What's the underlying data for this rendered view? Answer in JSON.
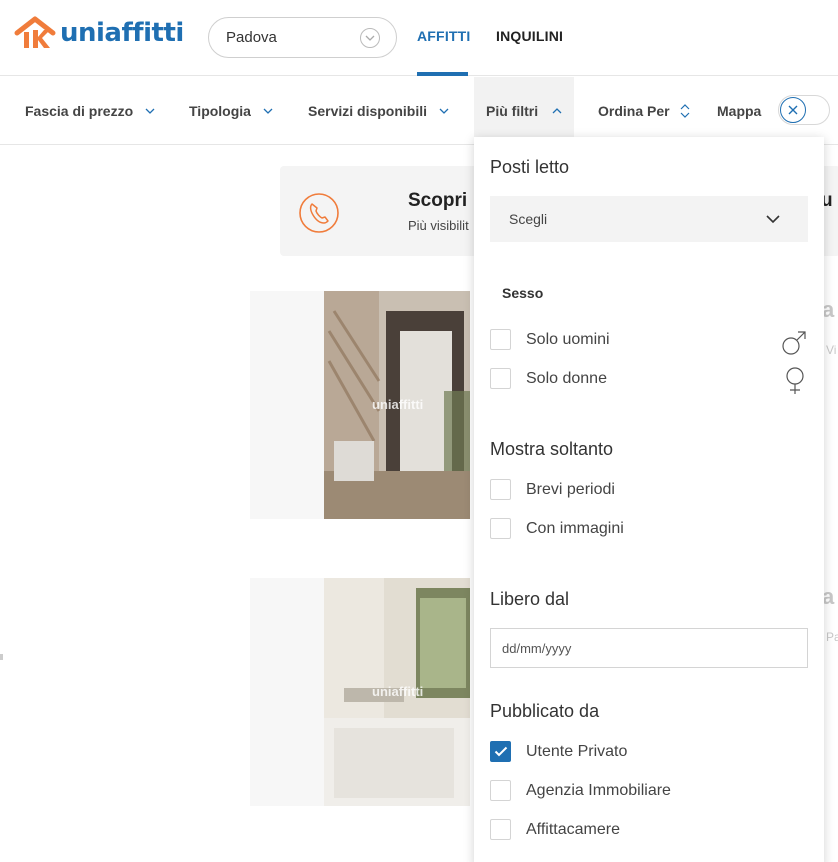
{
  "header": {
    "logo_text": "uniaffitti",
    "city_value": "Padova",
    "nav": {
      "affitti": "AFFITTI",
      "inquilini": "INQUILINI"
    }
  },
  "filters": {
    "price": "Fascia di prezzo",
    "type": "Tipologia",
    "services": "Servizi disponibili",
    "more": "Più filtri",
    "sort": "Ordina Per",
    "map": "Mappa"
  },
  "banner": {
    "title": "Scopri",
    "subtitle": "Più visibilit",
    "title_right": "u"
  },
  "cards": [
    {
      "watermark": "uniaffitti",
      "side_title": "a",
      "side_sub": "Vi"
    },
    {
      "watermark": "uniaffitti",
      "side_title": "a",
      "side_sub": "Pa"
    }
  ],
  "panel": {
    "beds": {
      "title": "Posti letto",
      "select_value": "Scegli"
    },
    "sex": {
      "title": "Sesso",
      "options": [
        {
          "label": "Solo uomini",
          "checked": false,
          "icon": "male-icon"
        },
        {
          "label": "Solo donne",
          "checked": false,
          "icon": "female-icon"
        }
      ]
    },
    "show_only": {
      "title": "Mostra soltanto",
      "options": [
        {
          "label": "Brevi periodi",
          "checked": false
        },
        {
          "label": "Con immagini",
          "checked": false
        }
      ]
    },
    "free_from": {
      "title": "Libero dal",
      "placeholder": "dd/mm/yyyy"
    },
    "published_by": {
      "title": "Pubblicato da",
      "options": [
        {
          "label": "Utente Privato",
          "checked": true
        },
        {
          "label": "Agenzia Immobiliare",
          "checked": false
        },
        {
          "label": "Affittacamere",
          "checked": false
        }
      ]
    }
  },
  "colors": {
    "brand_blue": "#1f6fb2",
    "brand_orange": "#f07c3b"
  }
}
